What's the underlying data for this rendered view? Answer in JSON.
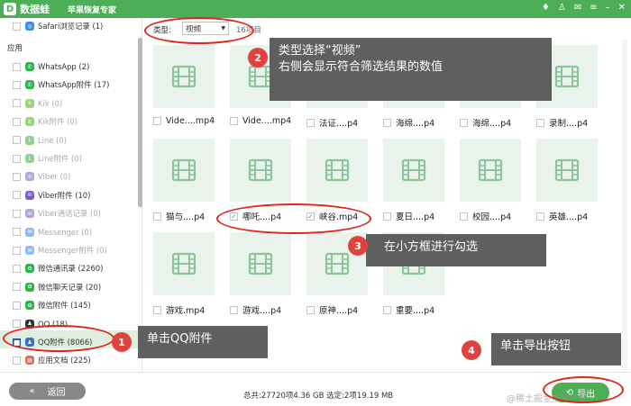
{
  "app": {
    "name": "数据蛙",
    "subtitle": "苹果恢复专家",
    "logo_letter": "D"
  },
  "window_controls": [
    "diamond-icon",
    "shirt-icon",
    "chat-icon",
    "menu-icon",
    "minimize-icon",
    "close-icon"
  ],
  "sidebar": {
    "top_item": {
      "label": "Safari浏览记录 (1)"
    },
    "section_app": "应用",
    "items": [
      {
        "label": "WhatsApp (2)",
        "icon": "whatsapp-icon",
        "color": "#2bb64a",
        "dim": false
      },
      {
        "label": "WhatsApp附件 (17)",
        "icon": "whatsapp-icon",
        "color": "#2bb64a",
        "dim": false
      },
      {
        "label": "Kik (0)",
        "icon": "kik-icon",
        "color": "#9bd47a",
        "dim": true
      },
      {
        "label": "Kik附件 (0)",
        "icon": "kik-icon",
        "color": "#9bd47a",
        "dim": true
      },
      {
        "label": "Line (0)",
        "icon": "line-icon",
        "color": "#8fd08f",
        "dim": true
      },
      {
        "label": "Line附件 (0)",
        "icon": "line-icon",
        "color": "#8fd08f",
        "dim": true
      },
      {
        "label": "Viber (0)",
        "icon": "viber-icon",
        "color": "#b6a4d8",
        "dim": true
      },
      {
        "label": "Viber附件 (10)",
        "icon": "viber-icon",
        "color": "#7b5cc8",
        "dim": false
      },
      {
        "label": "Viber通话记录 (0)",
        "icon": "viber-icon",
        "color": "#b6a4d8",
        "dim": true
      },
      {
        "label": "Messenger (0)",
        "icon": "messenger-icon",
        "color": "#8bbdf0",
        "dim": true
      },
      {
        "label": "Messenger附件 (0)",
        "icon": "messenger-icon",
        "color": "#8bbdf0",
        "dim": true
      },
      {
        "label": "微信通讯录 (2260)",
        "icon": "wechat-icon",
        "color": "#2bb64a",
        "dim": false
      },
      {
        "label": "微信聊天记录 (20)",
        "icon": "wechat-icon",
        "color": "#2bb64a",
        "dim": false
      },
      {
        "label": "微信附件 (145)",
        "icon": "wechat-icon",
        "color": "#2bb64a",
        "dim": false
      },
      {
        "label": "QQ (18)",
        "icon": "qq-icon",
        "color": "#333333",
        "dim": false
      },
      {
        "label": "QQ附件 (8066)",
        "icon": "qq-icon",
        "color": "#3a6fc4",
        "dim": false,
        "selected": true
      },
      {
        "label": "应用文档 (225)",
        "icon": "document-icon",
        "color": "#e06b5a",
        "dim": false
      }
    ]
  },
  "toolbar": {
    "type_label": "类型:",
    "type_value": "视频",
    "count": "16项目"
  },
  "files": [
    {
      "name": "Vide....mp4",
      "checked": false
    },
    {
      "name": "Vide....mp4",
      "checked": false
    },
    {
      "name": "法证....p4",
      "checked": false
    },
    {
      "name": "海绵....p4",
      "checked": false
    },
    {
      "name": "海绵....p4",
      "checked": false
    },
    {
      "name": "录制....p4",
      "checked": false
    },
    {
      "name": "猫与....p4",
      "checked": false
    },
    {
      "name": "哪吒....p4",
      "checked": true
    },
    {
      "name": "峡谷.mp4",
      "checked": true
    },
    {
      "name": "夏日....p4",
      "checked": false
    },
    {
      "name": "校园....p4",
      "checked": false
    },
    {
      "name": "英雄....p4",
      "checked": false
    },
    {
      "name": "游戏.mp4",
      "checked": false
    },
    {
      "name": "游戏....p4",
      "checked": false
    },
    {
      "name": "原神....p4",
      "checked": false
    },
    {
      "name": "重要....p4",
      "checked": false
    }
  ],
  "bottom": {
    "back_label": "返回",
    "summary": "总共:27720项4.36 GB 选定:2项19.19 MB",
    "export_label": "导出"
  },
  "watermark": "@稀土掘金技术社区",
  "callouts": {
    "c1": {
      "num": "1",
      "text": "单击QQ附件"
    },
    "c2": {
      "num": "2",
      "line1": "类型选择“视频”",
      "line2": "右侧会显示符合筛选结果的数值"
    },
    "c3": {
      "num": "3",
      "text": "在小方框进行勾选"
    },
    "c4": {
      "num": "4",
      "text": "单击导出按钮"
    }
  },
  "colors": {
    "brand_green": "#4dae57",
    "callout_bg": "#5f5f5f",
    "badge_red": "#e0433d",
    "highlight_red": "#e0251b"
  }
}
